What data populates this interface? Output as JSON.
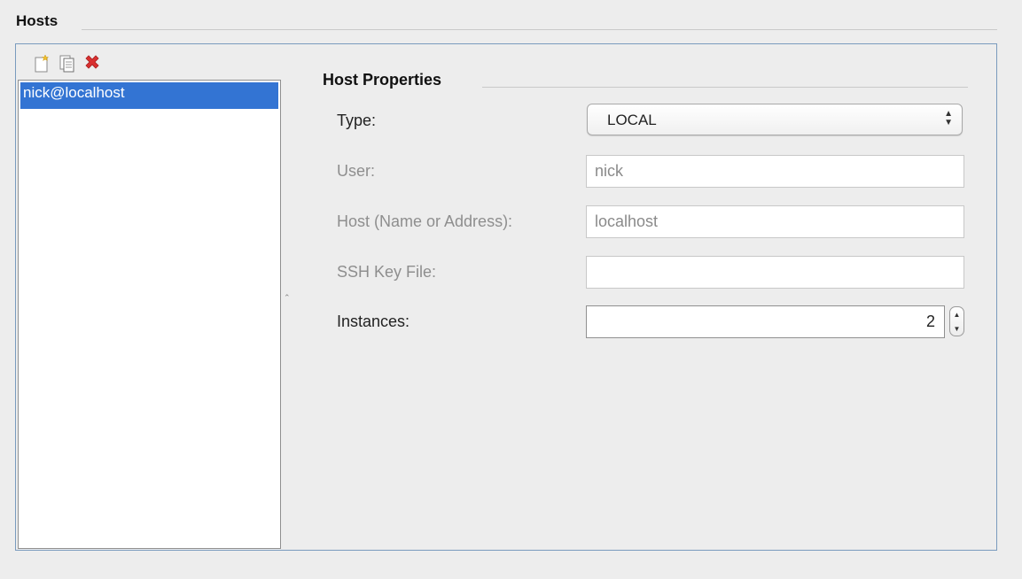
{
  "section": {
    "title": "Hosts"
  },
  "toolbar": {
    "buttons": [
      {
        "icon": "new-host-icon"
      },
      {
        "icon": "copy-host-icon"
      },
      {
        "icon": "delete-host-icon",
        "color": "#d93030"
      }
    ]
  },
  "host_list": {
    "items": [
      {
        "label": "nick@localhost",
        "selected": true
      }
    ],
    "selection_color": "#3374d3"
  },
  "properties": {
    "title": "Host Properties",
    "type_label": "Type:",
    "type_value": "LOCAL",
    "user_label": "User:",
    "user_value": "nick",
    "host_label": "Host (Name or Address):",
    "host_value": "localhost",
    "ssh_label": "SSH Key File:",
    "ssh_value": "",
    "instances_label": "Instances:",
    "instances_value": "2"
  }
}
